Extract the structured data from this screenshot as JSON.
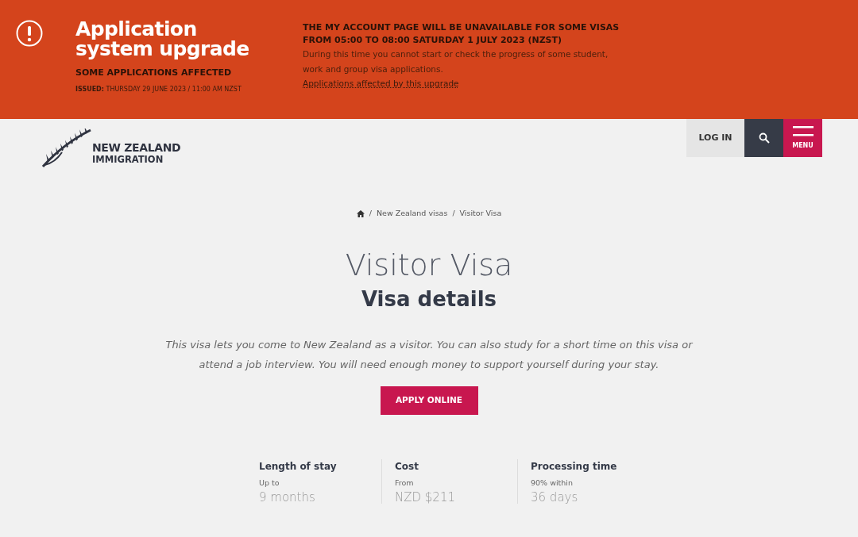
{
  "alert": {
    "title": "Application system upgrade",
    "subtitle": "SOME APPLICATIONS AFFECTED",
    "issued_label": "ISSUED:",
    "issued_text": "THURSDAY 29 JUNE 2023 / 11:00 AM NZST",
    "notice_heading": "THE MY ACCOUNT PAGE WILL BE UNAVAILABLE FOR SOME VISAS FROM 05:00 TO 08:00 SATURDAY 1 JULY 2023 (NZST)",
    "notice_text": "During this time you cannot start or check the progress of some student, work and group visa applications.",
    "notice_link": "Applications affected by this upgrade"
  },
  "header": {
    "logo_line1": "NEW ZEALAND",
    "logo_line2": "IMMIGRATION",
    "login": "LOG IN",
    "menu": "MENU"
  },
  "breadcrumb": [
    {
      "separator": "/",
      "label": "New Zealand visas"
    },
    {
      "separator": "/",
      "label": "Visitor Visa"
    }
  ],
  "page": {
    "title": "Visitor Visa",
    "subtitle": "Visa details",
    "description": "This visa lets you come to New Zealand as a visitor. You can also study for a short time on this visa or attend a job interview. You will need enough money to support yourself during your stay.",
    "apply": "APPLY ONLINE"
  },
  "stats": [
    {
      "label": "Length of stay",
      "qualifier": "Up to",
      "value": "9 months"
    },
    {
      "label": "Cost",
      "qualifier": "From",
      "value": "NZD $211"
    },
    {
      "label": "Processing time",
      "qualifier": "90% within",
      "value": "36 days"
    }
  ]
}
